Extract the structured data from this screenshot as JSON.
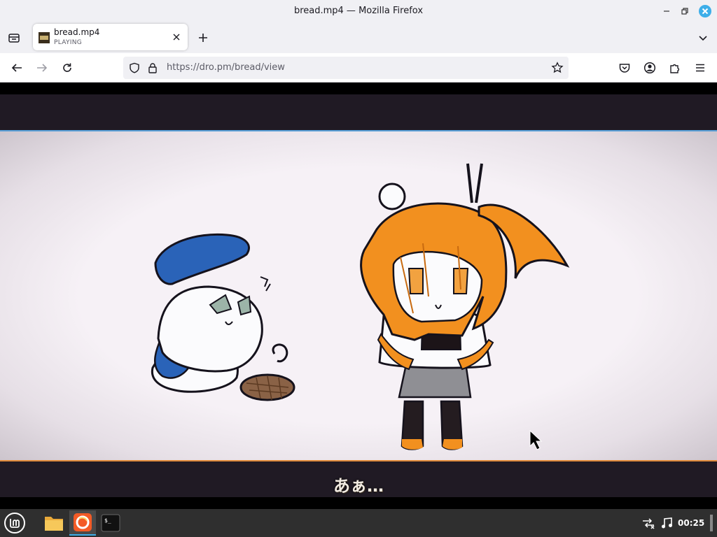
{
  "window": {
    "title": "bread.mp4 — Mozilla Firefox"
  },
  "tab": {
    "title": "bread.mp4",
    "status": "PLAYING"
  },
  "navbar": {
    "url": "https://dro.pm/bread/view"
  },
  "video": {
    "subtitle": "あぁ…"
  },
  "taskbar": {
    "clock": "00:25"
  },
  "icons": [
    "firefox-view-icon",
    "close-tab-icon",
    "new-tab-icon",
    "list-all-tabs-icon",
    "back-icon",
    "forward-icon",
    "reload-icon",
    "shield-icon",
    "lock-icon",
    "bookmark-star-icon",
    "pocket-icon",
    "account-icon",
    "extensions-icon",
    "menu-icon",
    "mint-menu-icon",
    "files-icon",
    "firefox-icon",
    "terminal-icon",
    "network-icon",
    "music-icon"
  ],
  "colors": {
    "accent": "#0a84ff",
    "close": "#3daee9",
    "hair": "#f2901f",
    "beret": "#2a63b8",
    "taskbar": "#2f2f2f"
  }
}
